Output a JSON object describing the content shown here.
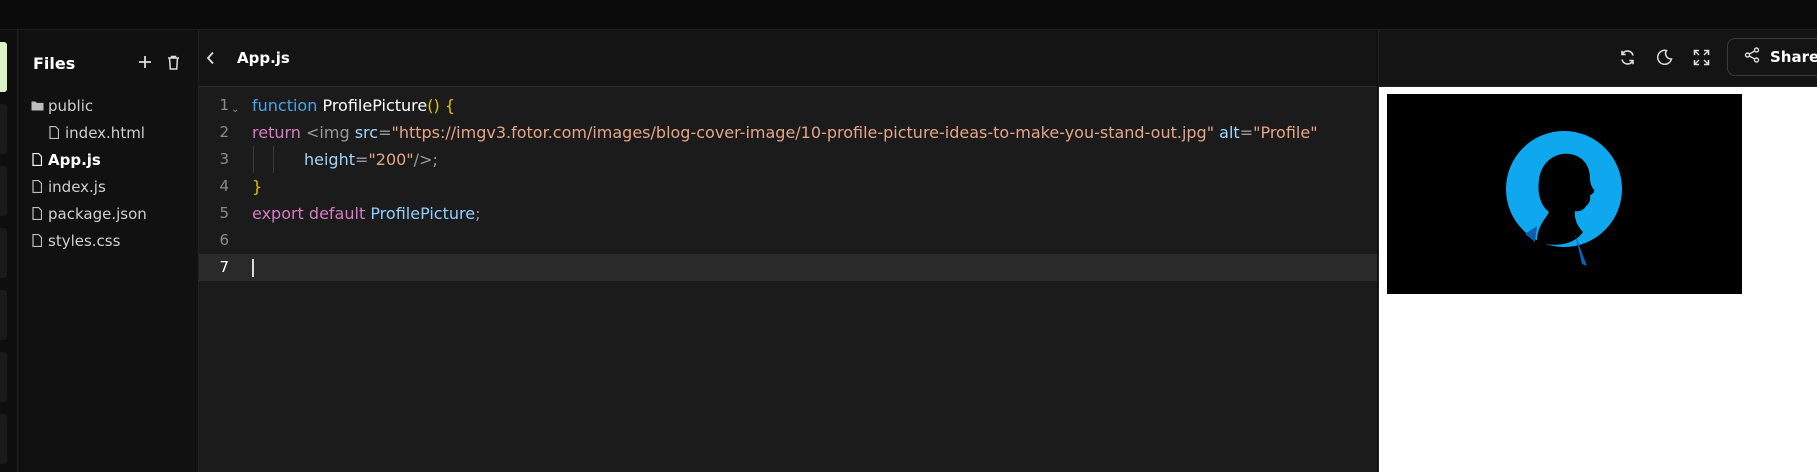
{
  "sidebar": {
    "title": "Files",
    "items": [
      {
        "label": "public",
        "type": "folder",
        "child": false,
        "selected": false
      },
      {
        "label": "index.html",
        "type": "file",
        "child": true,
        "selected": false
      },
      {
        "label": "App.js",
        "type": "file",
        "child": false,
        "selected": true
      },
      {
        "label": "index.js",
        "type": "file",
        "child": false,
        "selected": false
      },
      {
        "label": "package.json",
        "type": "file",
        "child": false,
        "selected": false
      },
      {
        "label": "styles.css",
        "type": "file",
        "child": false,
        "selected": false
      }
    ]
  },
  "editor": {
    "tab_title": "App.js",
    "line_numbers": [
      "1",
      "2",
      "3",
      "4",
      "5",
      "6",
      "7"
    ],
    "line1": {
      "kw": "function",
      "name": "ProfilePicture",
      "paren": "()",
      "brace": "{"
    },
    "line2": {
      "kw": "return",
      "tag": "<img",
      "attr_src": "src",
      "eq": "=",
      "src_val": "\"https://imgv3.fotor.com/images/blog-cover-image/10-profile-picture-ideas-to-make-you-stand-out.jpg\"",
      "attr_alt": "alt",
      "alt_val": "\"Profile\""
    },
    "line3": {
      "attr_height": "height",
      "height_val": "\"200\"",
      "close": "/>;"
    },
    "line4": {
      "brace": "}"
    },
    "line5": {
      "kw": "export default",
      "name": "ProfilePicture",
      "semi": ";"
    }
  },
  "preview": {
    "share_label": "Share",
    "image_alt": "Profile"
  },
  "icons": [
    "add-file-icon",
    "delete-icon",
    "chevron-left-icon",
    "refresh-icon",
    "dark-mode-icon",
    "fullscreen-icon",
    "share-icon",
    "folder-icon",
    "file-icon"
  ]
}
